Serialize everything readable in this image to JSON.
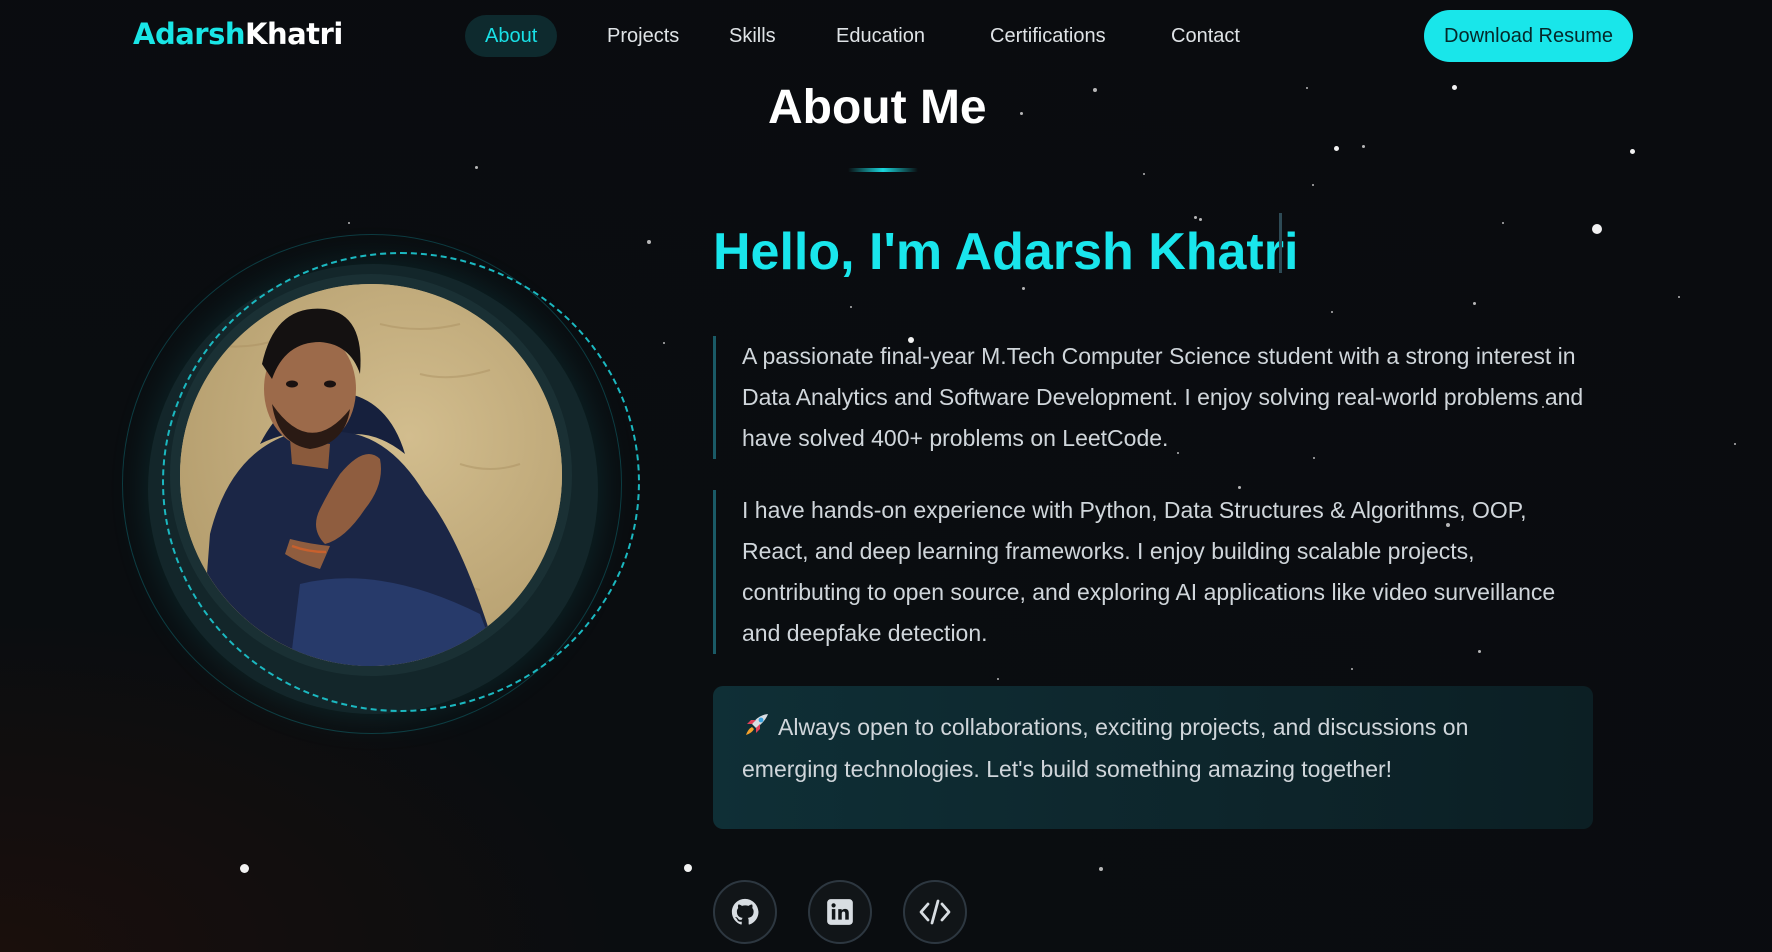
{
  "brand": {
    "first": "Adarsh",
    "last": "Khatri"
  },
  "nav": {
    "items": [
      "About",
      "Projects",
      "Skills",
      "Education",
      "Certifications",
      "Contact"
    ],
    "active": "About",
    "download_label": "Download Resume"
  },
  "about": {
    "title": "About Me",
    "greeting": "Hello, I'm Adarsh Khatri",
    "paragraph1": "A passionate final-year M.Tech Computer Science student with a strong interest in Data Analytics and Software Development. I enjoy solving real-world problems and have solved 400+ problems on LeetCode.",
    "paragraph2": "I have hands-on experience with Python, Data Structures & Algorithms, OOP, React, and deep learning frameworks. I enjoy building scalable projects, contributing to open source, and exploring AI applications like video surveillance and deepfake detection.",
    "callout": "Always open to collaborations, exciting projects, and discussions on emerging technologies. Let's build something amazing together!"
  },
  "social": [
    {
      "icon": "github-icon"
    },
    {
      "icon": "linkedin-icon"
    },
    {
      "icon": "code-icon"
    }
  ],
  "colors": {
    "accent": "#19e6ec",
    "background": "#0a0c0f",
    "text": "#d0d6db"
  }
}
